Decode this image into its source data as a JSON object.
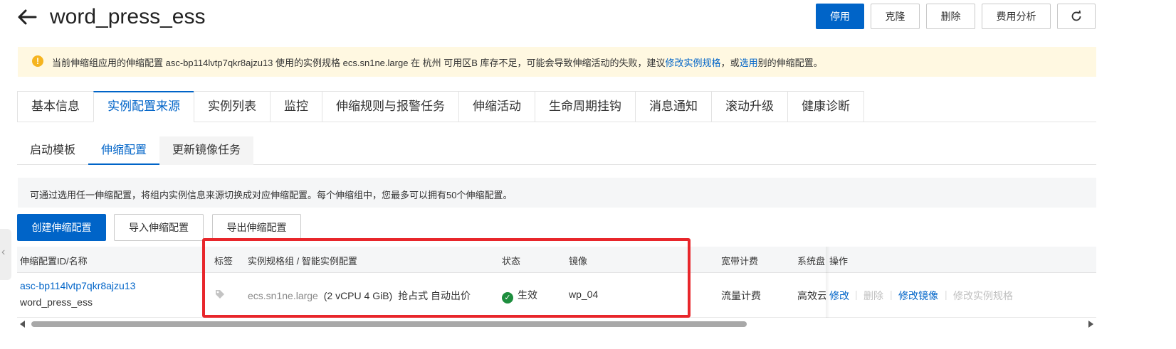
{
  "header": {
    "title": "word_press_ess",
    "buttons": {
      "disable": "停用",
      "clone": "克隆",
      "delete": "删除",
      "cost": "费用分析"
    }
  },
  "warning": {
    "text_before": "当前伸缩组应用的伸缩配置 asc-bp114lvtp7qkr8ajzu13 使用的实例规格 ecs.sn1ne.large 在 杭州 可用区B 库存不足，可能会导致伸缩活动的失败，建议",
    "link1": "修改实例规格",
    "text_mid": "，或",
    "link2": "选用",
    "text_after": "别的伸缩配置。"
  },
  "main_tabs": [
    "基本信息",
    "实例配置来源",
    "实例列表",
    "监控",
    "伸缩规则与报警任务",
    "伸缩活动",
    "生命周期挂钩",
    "消息通知",
    "滚动升级",
    "健康诊断"
  ],
  "sub_tabs": [
    "启动模板",
    "伸缩配置",
    "更新镜像任务"
  ],
  "info_text": "可通过选用任一伸缩配置，将组内实例信息来源切换成对应伸缩配置。每个伸缩组中，您最多可以拥有50个伸缩配置。",
  "actions": {
    "create": "创建伸缩配置",
    "import": "导入伸缩配置",
    "export": "导出伸缩配置"
  },
  "table": {
    "headers": {
      "id": "伸缩配置ID/名称",
      "tag": "标签",
      "spec": "实例规格组 / 智能实例配置",
      "status": "状态",
      "image": "镜像",
      "bandwidth": "宽带计费",
      "disk": "系统盘",
      "ops": "操作"
    },
    "row": {
      "id": "asc-bp114lvtp7qkr8ajzu13",
      "name": "word_press_ess",
      "spec": "ecs.sn1ne.large",
      "spec_detail": "(2 vCPU 4 GiB)",
      "spec_bid": "抢占式 自动出价",
      "status": "生效",
      "image": "wp_04",
      "bandwidth": "流量计费",
      "disk": "高效云",
      "op_modify": "修改",
      "op_delete": "删除",
      "op_modify_image": "修改镜像",
      "op_modify_spec": "修改实例规格"
    }
  },
  "colors": {
    "primary": "#0064c8",
    "warning_bg": "#fff8e1",
    "highlight": "#e8262b",
    "success": "#1e8e3e"
  }
}
